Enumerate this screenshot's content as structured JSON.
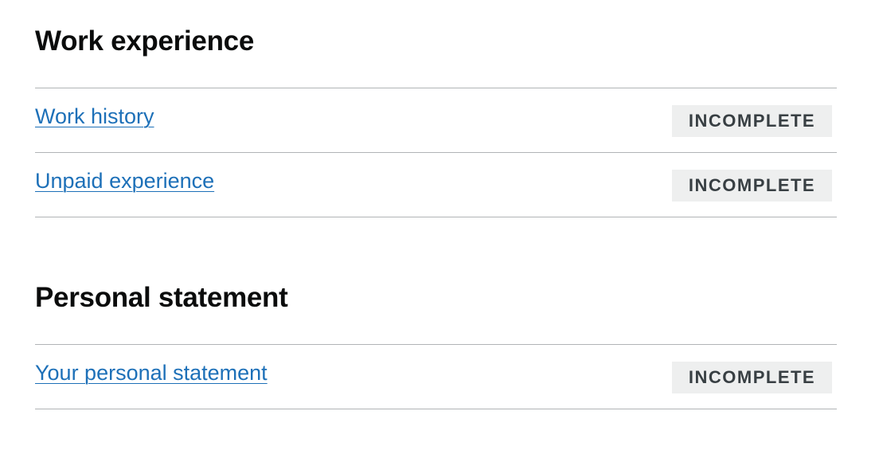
{
  "sections": [
    {
      "title": "Work experience",
      "items": [
        {
          "label": "Work history",
          "status": "INCOMPLETE"
        },
        {
          "label": "Unpaid experience",
          "status": "INCOMPLETE"
        }
      ]
    },
    {
      "title": "Personal statement",
      "items": [
        {
          "label": "Your personal statement",
          "status": "INCOMPLETE"
        }
      ]
    }
  ],
  "colors": {
    "link": "#1d70b8",
    "tag_bg": "#eeefef",
    "tag_text": "#383f43"
  }
}
